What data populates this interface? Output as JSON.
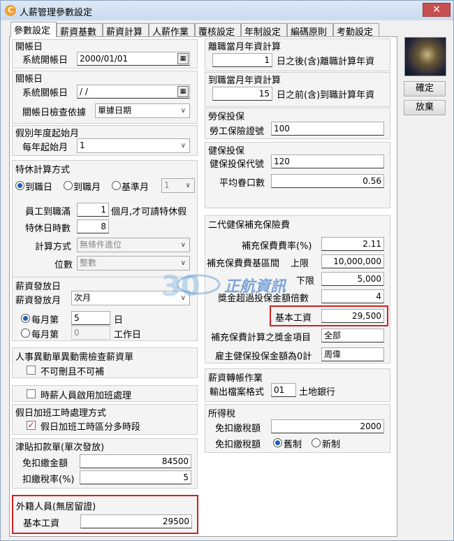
{
  "window": {
    "title": "人薪管理參數設定",
    "close": "✕",
    "app_icon": "C"
  },
  "tabs": [
    {
      "label": "參數設定",
      "active": true
    },
    {
      "label": "薪資基數"
    },
    {
      "label": "薪資計算"
    },
    {
      "label": "人薪作業"
    },
    {
      "label": "覆核設定"
    },
    {
      "label": "年制設定"
    },
    {
      "label": "編碼原則"
    },
    {
      "label": "考勤設定"
    }
  ],
  "buttons": {
    "ok": "確定",
    "cancel": "放棄"
  },
  "left": {
    "open_account": {
      "title": "開帳日",
      "system_label": "系統開帳日",
      "date": "2000/01/01"
    },
    "close_account": {
      "title": "關帳日",
      "system_label": "系統關帳日",
      "date": "/ /",
      "check_label": "關帳日檢查依據",
      "check_value": "單據日期"
    },
    "leave_year": {
      "title": "假別年度起始月",
      "label": "每年起始月",
      "value": "1"
    },
    "annual_leave": {
      "title": "特休計算方式",
      "opt1": "到職日",
      "opt2": "到職月",
      "opt3": "基準月",
      "base_month": "1",
      "staff_label": "員工到職滿",
      "staff_value": "1",
      "staff_suffix": "個月,才可請特休假",
      "hours_label": "特休日時數",
      "hours_value": "8",
      "method_label": "計算方式",
      "method_value": "無條件進位",
      "digits_label": "位數",
      "digits_value": "整數"
    },
    "pay_day": {
      "title": "薪資發放日",
      "month_label": "薪資發放月",
      "month_value": "次月",
      "opt1": "每月第",
      "opt1_value": "5",
      "opt1_suffix": "日",
      "opt2": "每月第",
      "opt2_value": "0",
      "opt2_suffix": "工作日"
    },
    "transfer": {
      "title": "人事異動單異動需檢查薪資單",
      "check_label": "不可刪且不可補"
    },
    "hourly_ot": {
      "check_label": "時薪人員啟用加班處理"
    },
    "holiday_ot": {
      "title": "假日加班工時處理方式",
      "check_label": "假日加班工時區分多時段"
    },
    "allowance": {
      "title": "津貼扣款單(單次發放)",
      "exempt_label": "免扣繳金額",
      "exempt_value": "84500",
      "rate_label": "扣繳稅率(%)",
      "rate_value": "5"
    },
    "foreign": {
      "title": "外籍人員(無居留證)",
      "base_label": "基本工資",
      "base_value": "29500"
    }
  },
  "right": {
    "resign": {
      "title": "離職當月年資計算",
      "value": "1",
      "suffix": "日之後(含)離職計算年資"
    },
    "onboard": {
      "title": "到職當月年資計算",
      "value": "15",
      "suffix": "日之前(含)到職計算年資"
    },
    "labor": {
      "title": "勞保投保",
      "label": "勞工保險證號",
      "value": "100"
    },
    "health": {
      "title": "健保投保",
      "code_label": "健保投保代號",
      "code_value": "120",
      "avg_label": "平均眷口數",
      "avg_value": "0.56"
    },
    "supplement": {
      "title": "二代健保補充保險費",
      "rate_label": "補充保費費率(%)",
      "rate_value": "2.11",
      "range_label": "補充保費費基區間",
      "upper_label": "上限",
      "upper_value": "10,000,000",
      "lower_label": "下限",
      "lower_value": "5,000",
      "bonus_label": "獎金超過投保金額倍數",
      "bonus_value": "4",
      "base_label": "基本工資",
      "base_value": "29,500",
      "item_label": "補充保費計算之獎金項目",
      "item_value": "全部",
      "employer_label": "雇主健保投保金額為0計",
      "employer_value": "周偉"
    },
    "transfer_pay": {
      "title": "薪資轉帳作業",
      "label": "輸出檔案格式",
      "code": "01",
      "bank": "土地銀行"
    },
    "income_tax": {
      "title": "所得稅",
      "exempt_label": "免扣繳稅額",
      "exempt_value": "2000",
      "mode_label": "免扣繳稅額",
      "opt_old": "舊制",
      "opt_new": "新制"
    }
  },
  "watermark": {
    "text": "正航資訊",
    "digits": "30"
  }
}
